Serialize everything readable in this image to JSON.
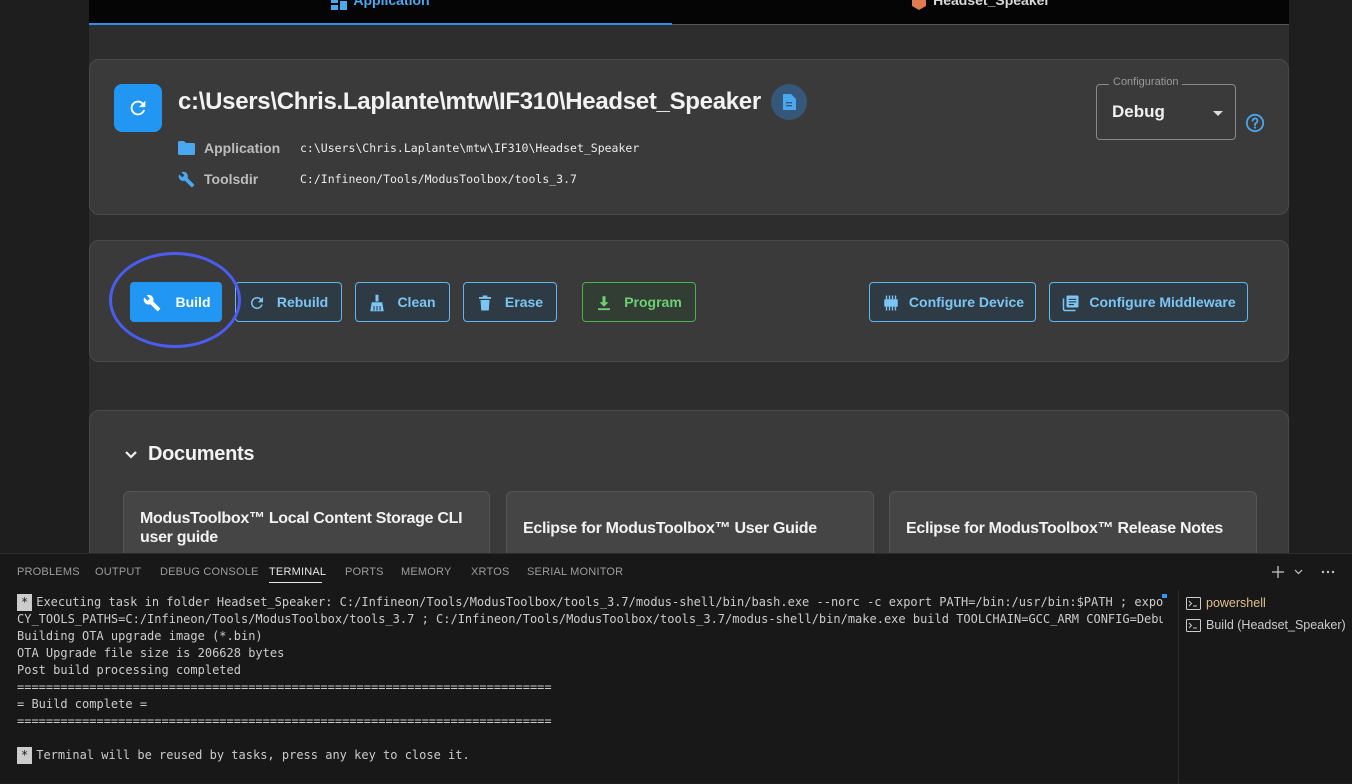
{
  "tabs": {
    "application": "Application",
    "headset_speaker": "Headset_Speaker"
  },
  "app": {
    "title": "c:\\Users\\Chris.Laplante\\mtw\\IF310\\Headset_Speaker",
    "application_label": "Application",
    "application_value": "c:\\Users\\Chris.Laplante\\mtw\\IF310\\Headset_Speaker",
    "toolsdir_label": "Toolsdir",
    "toolsdir_value": "C:/Infineon/Tools/ModusToolbox/tools_3.7"
  },
  "configuration": {
    "legend": "Configuration",
    "value": "Debug"
  },
  "actions": {
    "build": "Build",
    "rebuild": "Rebuild",
    "clean": "Clean",
    "erase": "Erase",
    "program": "Program",
    "configure_device": "Configure Device",
    "configure_middleware": "Configure Middleware"
  },
  "documents": {
    "heading": "Documents",
    "items": [
      "ModusToolbox™ Local Content Storage CLI user guide",
      "Eclipse for ModusToolbox™ User Guide",
      "Eclipse for ModusToolbox™ Release Notes"
    ]
  },
  "panel": {
    "tabs": [
      "PROBLEMS",
      "OUTPUT",
      "DEBUG CONSOLE",
      "TERMINAL",
      "PORTS",
      "MEMORY",
      "XRTOS",
      "SERIAL MONITOR"
    ],
    "active_tab": "TERMINAL"
  },
  "terminal": {
    "star": "*",
    "lines": [
      "Executing task in folder Headset_Speaker: C:/Infineon/Tools/ModusToolbox/tools_3.7/modus-shell/bin/bash.exe --norc -c export PATH=/bin:/usr/bin:$PATH ; export",
      "CY_TOOLS_PATHS=C:/Infineon/Tools/ModusToolbox/tools_3.7 ; C:/Infineon/Tools/ModusToolbox/tools_3.7/modus-shell/bin/make.exe build TOOLCHAIN=GCC_ARM CONFIG=Debug",
      "Building OTA upgrade image (*.bin)",
      "OTA Upgrade file size is 206628 bytes",
      "Post build processing completed",
      "==========================================================================",
      "= Build complete =",
      "==========================================================================",
      "",
      "Terminal will be reused by tasks, press any key to close it."
    ]
  },
  "terminal_list": {
    "items": [
      "powershell",
      "Build (Headset_Speaker)"
    ]
  },
  "colors": {
    "accent": "#2196f3",
    "program": "#4caf50",
    "highlight_ring": "#4b5cf0"
  }
}
